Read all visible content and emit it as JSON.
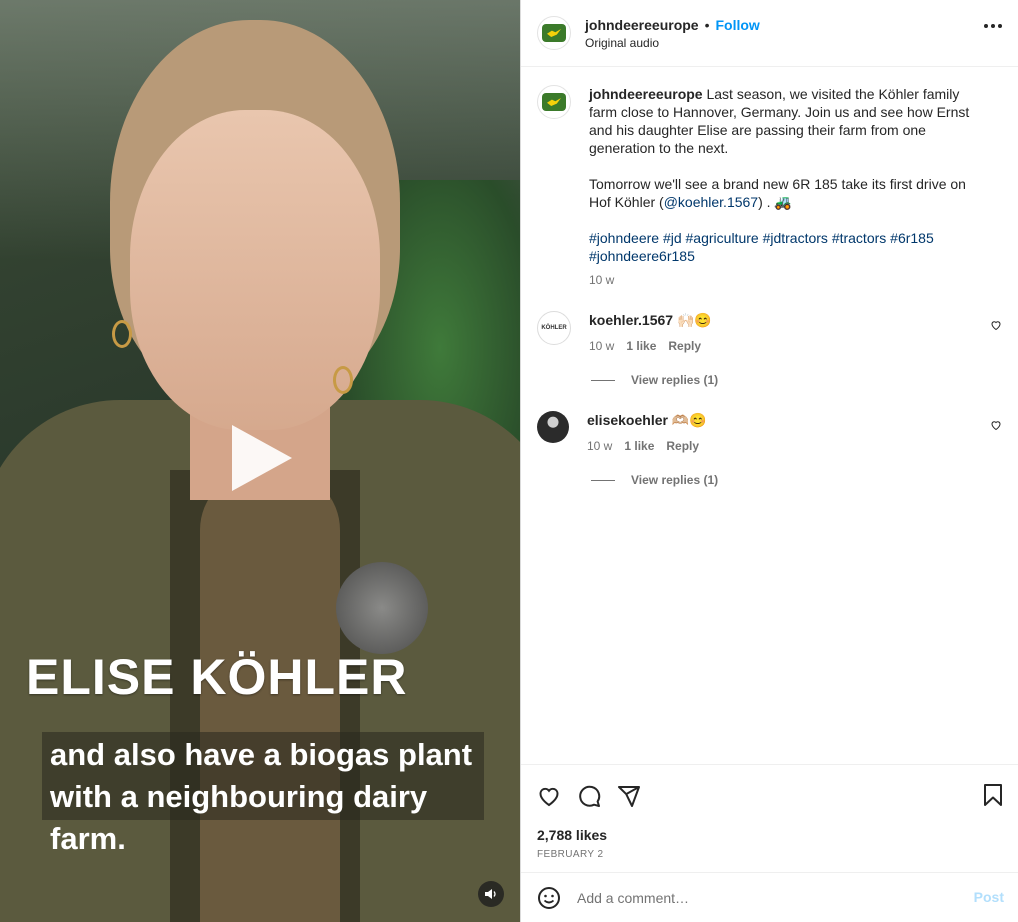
{
  "video": {
    "name_caption": "ELISE KÖHLER",
    "subtitle_line1": "and also have a biogas plant",
    "subtitle_line2": "with a neighbouring dairy farm."
  },
  "header": {
    "username": "johndeereeurope",
    "separator": "•",
    "follow_label": "Follow",
    "audio": "Original audio"
  },
  "caption": {
    "username": "johndeereeurope",
    "text1": "Last season, we visited the Köhler family farm close to Hannover, Germany. Join us and see how Ernst and his daughter Elise are passing their farm from one generation to the next.",
    "text2_before": "Tomorrow we'll see a brand new 6R 185 take its first drive on Hof Köhler (",
    "mention": "@koehler.1567",
    "text2_after": ") . 🚜",
    "hashtags": "#johndeere #jd #agriculture #jdtractors #tractors #6r185 #johndeere6r185",
    "time": "10 w"
  },
  "comments": [
    {
      "username": "koehler.1567",
      "text": "🙌🏻😊",
      "time": "10 w",
      "likes": "1 like",
      "reply": "Reply",
      "view_replies": "View replies (1)",
      "avatar_text": "KÖHLER"
    },
    {
      "username": "elisekoehler",
      "text": "🫶🏼😊",
      "time": "10 w",
      "likes": "1 like",
      "reply": "Reply",
      "view_replies": "View replies (1)"
    }
  ],
  "footer": {
    "likes": "2,788 likes",
    "date": "FEBRUARY 2",
    "comment_placeholder": "Add a comment…",
    "post_label": "Post"
  },
  "colors": {
    "accent": "#0095f6",
    "brand_green": "#3b7a2a",
    "brand_yellow": "#f5d10a"
  }
}
